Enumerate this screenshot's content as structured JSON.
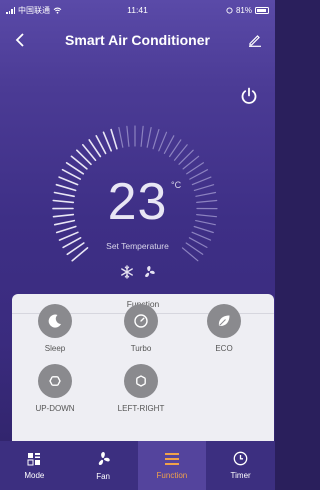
{
  "status_bar": {
    "carrier": "中国联通",
    "time": "11:41",
    "battery": "81%"
  },
  "nav": {
    "title": "Smart Air Conditioner"
  },
  "thermostat": {
    "temperature": "23",
    "unit": "°C",
    "label": "Set Temperature"
  },
  "function_panel": {
    "title": "Function",
    "items": [
      {
        "label": "Sleep",
        "icon": "moon-icon"
      },
      {
        "label": "Turbo",
        "icon": "speedometer-icon"
      },
      {
        "label": "ECO",
        "icon": "leaf-icon"
      },
      {
        "label": "UP-DOWN",
        "icon": "up-down-swing-icon"
      },
      {
        "label": "LEFT-RIGHT",
        "icon": "left-right-swing-icon"
      }
    ]
  },
  "tabs": [
    {
      "label": "Mode",
      "icon": "mode-grid-icon",
      "active": false
    },
    {
      "label": "Fan",
      "icon": "fan-icon",
      "active": false
    },
    {
      "label": "Function",
      "icon": "menu-lines-icon",
      "active": true
    },
    {
      "label": "Timer",
      "icon": "clock-icon",
      "active": false
    }
  ],
  "colors": {
    "background_top": "#5a4aa8",
    "background_bottom": "#2e2266",
    "active_tab_text": "#f0a14a",
    "panel_bg": "#eeeef3",
    "function_circle": "#8a8a8e"
  }
}
